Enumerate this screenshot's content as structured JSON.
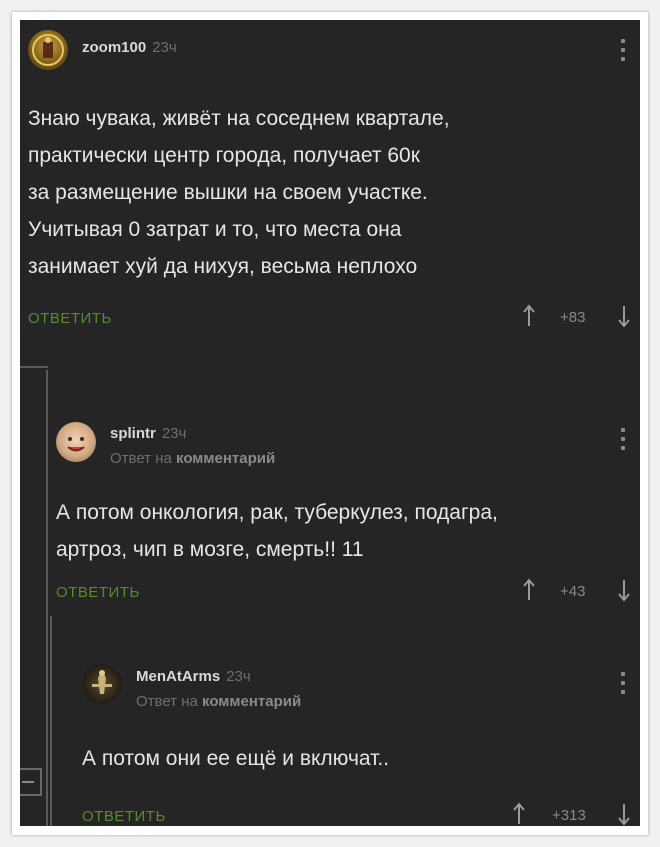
{
  "comments": [
    {
      "author": "zoom100",
      "time": "23ч",
      "reply_to": null,
      "text_lines": [
        "Знаю чувака, живёт на соседнем квартале,",
        "практически центр города, получает 60к",
        "за размещение вышки на своем участке.",
        "Учитывая 0 затрат и то, что места она",
        "занимает хуй да нихуя, весьма неплохо"
      ],
      "reply_label": "ОТВЕТИТЬ",
      "rating": "+83"
    },
    {
      "author": "splintr",
      "time": "23ч",
      "reply_to": {
        "prefix": "Ответ на",
        "target": "комментарий"
      },
      "text_lines": [
        "А потом онкология, рак, туберкулез, подагра,",
        "артроз, чип в мозге, смерть!! 11"
      ],
      "reply_label": "ОТВЕТИТЬ",
      "rating": "+43"
    },
    {
      "author": "MenAtArms",
      "time": "23ч",
      "reply_to": {
        "prefix": "Ответ на",
        "target": "комментарий"
      },
      "text_lines": [
        "А потом они ее ещё и включат.."
      ],
      "reply_label": "ОТВЕТИТЬ",
      "rating": "+313"
    }
  ],
  "colors": {
    "background": "#252525",
    "text": "#e6e6e6",
    "accent_reply": "#5a8a2f",
    "meta": "#6f6f6f"
  },
  "icons": [
    "avatar-zoom100",
    "avatar-splintr",
    "avatar-menatarms",
    "more-options-icon",
    "upvote-arrow-icon",
    "downvote-arrow-icon",
    "collapse-thread-icon"
  ]
}
